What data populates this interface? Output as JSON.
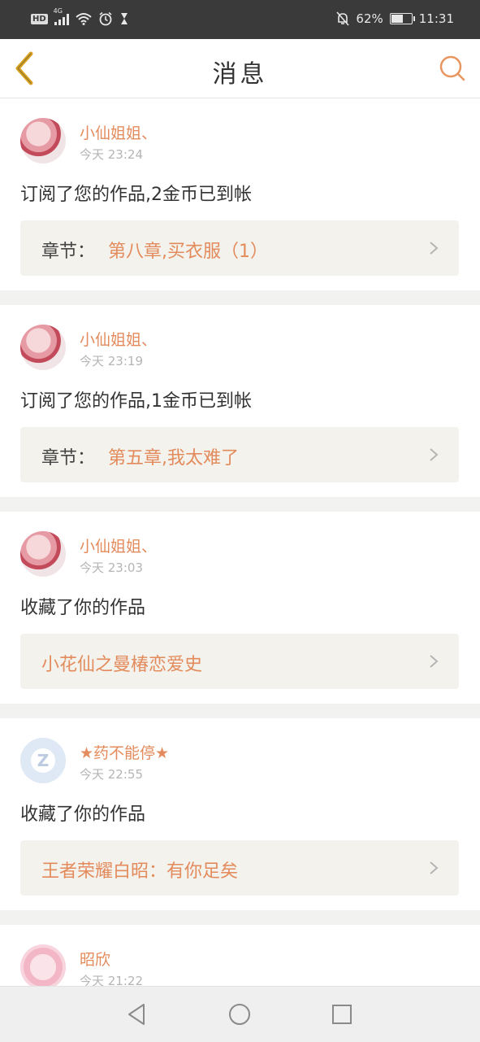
{
  "status_bar": {
    "hd": "HD",
    "network": "4G",
    "battery_text": "62%",
    "battery_level": 0.62,
    "time": "11:31"
  },
  "header": {
    "title": "消息",
    "icons": {
      "back": "back-chevron-icon",
      "search": "search-icon"
    }
  },
  "messages": [
    {
      "avatar": "girl-avatar",
      "name": "小仙姐姐、",
      "time": "今天 23:24",
      "text": "订阅了您的作品,2金币已到帐",
      "work_label": "章节：",
      "work_title": "第八章,买衣服（1）"
    },
    {
      "avatar": "girl-avatar",
      "name": "小仙姐姐、",
      "time": "今天 23:19",
      "text": "订阅了您的作品,1金币已到帐",
      "work_label": "章节：",
      "work_title": "第五章,我太难了"
    },
    {
      "avatar": "girl-avatar",
      "name": "小仙姐姐、",
      "time": "今天 23:03",
      "text": "收藏了你的作品",
      "work_label": "",
      "work_title": "小花仙之曼椿恋爱史"
    },
    {
      "avatar": "default-avatar",
      "name": "★药不能停★",
      "time": "今天 22:55",
      "text": "收藏了你的作品",
      "work_label": "",
      "work_title": "王者荣耀白昭：有你足矣"
    },
    {
      "avatar": "bunny-avatar",
      "name": "昭欣",
      "time": "今天 21:22"
    }
  ],
  "nav": {
    "back": "nav-back-icon",
    "home": "nav-home-icon",
    "recent": "nav-recent-icon"
  },
  "colors": {
    "accent": "#e38b5c",
    "back_icon": "#d9a322",
    "work_box": "#f3f2ec"
  }
}
